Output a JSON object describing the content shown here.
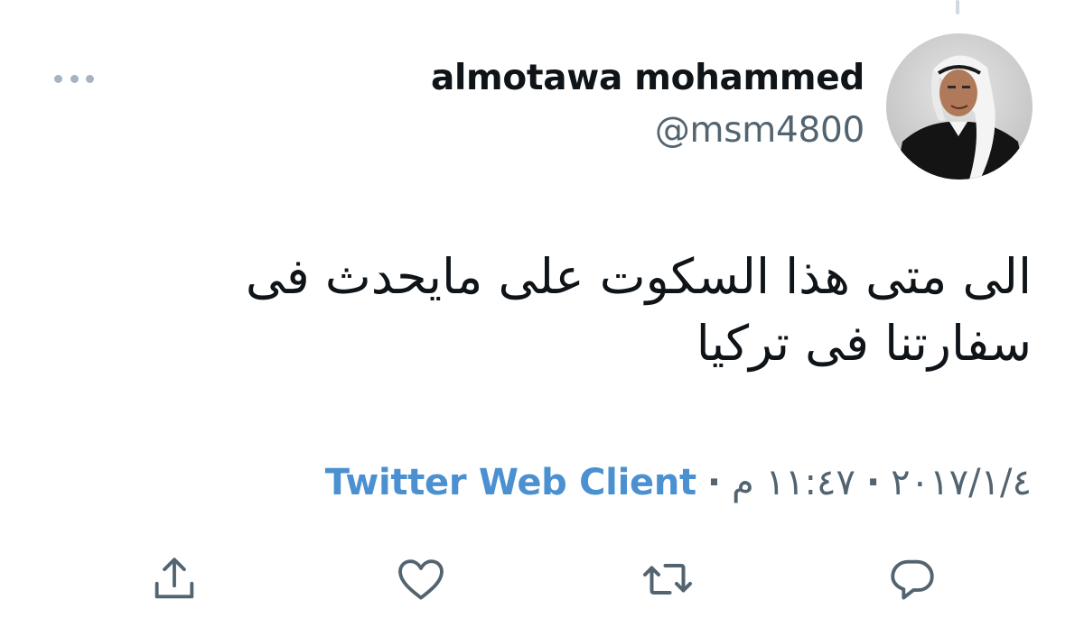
{
  "tweet": {
    "display_name": "almotawa mohammed",
    "handle": "@msm4800",
    "text": "الى متى هذا السكوت على مايحدث فى سفارتنا فى تركيا",
    "date": "٢٠١٧/١/٤",
    "time": "١١:٤٧ م",
    "separator": "·",
    "source": "Twitter Web Client"
  },
  "icons": {
    "more": "more-horizontal-icon",
    "reply": "reply-bubble-icon",
    "retweet": "retweet-icon",
    "like": "heart-icon",
    "share": "share-upload-icon"
  },
  "colors": {
    "text_primary": "#0f1419",
    "text_secondary": "#536471",
    "link": "#4b90d0",
    "icon_gray": "#536471",
    "more_dots": "#a5b4c0"
  }
}
